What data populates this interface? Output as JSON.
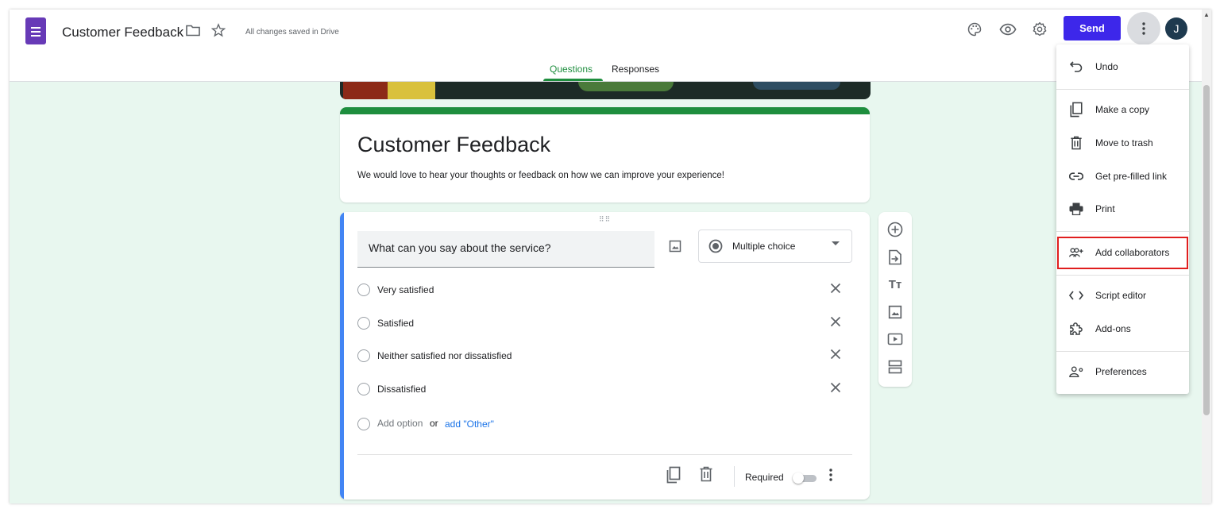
{
  "header": {
    "title": "Customer Feedback",
    "save_status": "All changes saved in Drive",
    "send_label": "Send",
    "avatar_initial": "J"
  },
  "tabs": [
    {
      "label": "Questions",
      "active": true
    },
    {
      "label": "Responses",
      "active": false
    }
  ],
  "form": {
    "title": "Customer Feedback",
    "description": "We would love to hear your thoughts or feedback on how we can improve your experience!"
  },
  "question": {
    "text": "What can you say about the service?",
    "type": "Multiple choice",
    "options": [
      "Very satisfied",
      "Satisfied",
      "Neither satisfied nor dissatisfied",
      "Dissatisfied"
    ],
    "add_option": "Add option",
    "or": "or",
    "add_other": "add \"Other\"",
    "required_label": "Required",
    "required": false
  },
  "menu": {
    "items": [
      {
        "label": "Undo",
        "icon": "undo-icon"
      },
      {
        "label": "Make a copy",
        "icon": "copy-icon"
      },
      {
        "label": "Move to trash",
        "icon": "trash-icon"
      },
      {
        "label": "Get pre-filled link",
        "icon": "link-icon"
      },
      {
        "label": "Print",
        "icon": "print-icon"
      },
      {
        "label": "Add collaborators",
        "icon": "add-people-icon",
        "highlighted": true
      },
      {
        "label": "Script editor",
        "icon": "code-icon"
      },
      {
        "label": "Add-ons",
        "icon": "puzzle-icon"
      },
      {
        "label": "Preferences",
        "icon": "preferences-icon"
      }
    ]
  },
  "colors": {
    "brand": "#673ab7",
    "send_button": "#3d27ea",
    "theme_green": "#1e8e3e",
    "background": "#e8f7ef",
    "question_accent": "#4285f4",
    "highlight_box": "#e01e1e"
  }
}
